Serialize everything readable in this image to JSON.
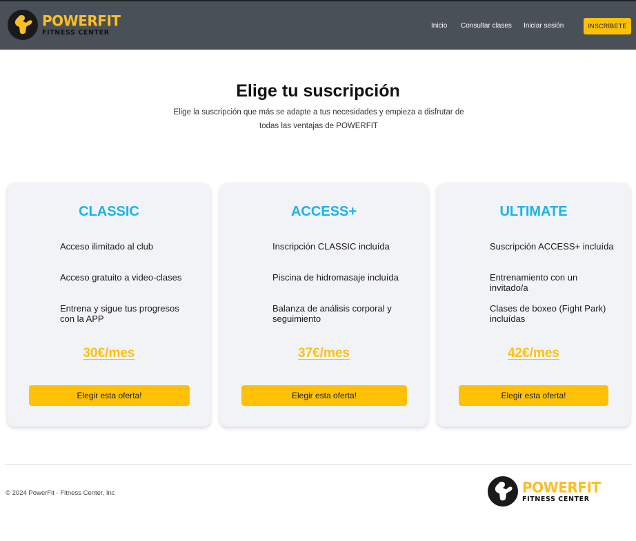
{
  "brand": {
    "name": "POWERFIT",
    "subtitle": "FITNESS CENTER",
    "color": "#fbbf24"
  },
  "nav": {
    "links": [
      "Inicio",
      "Consultar clases",
      "Iniciar sesión"
    ],
    "cta": "INSCRÍBETE"
  },
  "hero": {
    "title": "Elige tu suscripción",
    "subtitle": "Elige la suscripción que más se adapte a tus necesidades y empieza a disfrutar de todas las ventajas de POWERFIT"
  },
  "plans": [
    {
      "name": "CLASSIC",
      "features": [
        "Acceso ilimitado al club",
        "Acceso gratuito a video-clases",
        "Entrena y sigue tus progresos con la APP"
      ],
      "price": "30€/mes",
      "button": "Elegir esta oferta!"
    },
    {
      "name": "ACCESS+",
      "features": [
        "Inscripción CLASSIC incluída",
        "Piscina de hidromasaje incluída",
        "Balanza de análisis corporal y seguimiento"
      ],
      "price": "37€/mes",
      "button": "Elegir esta oferta!"
    },
    {
      "name": "ULTIMATE",
      "features": [
        "Suscripción ACCESS+ incluída",
        "Entrenamiento con un invitado/a",
        "Clases de boxeo (Fight Park) incluídas"
      ],
      "price": "42€/mes",
      "button": "Elegir esta oferta!"
    }
  ],
  "footer": {
    "copyright": "© 2024 PowerFit - Fitness Center, Inc"
  },
  "colors": {
    "accent": "#ffc107",
    "plan_title": "#1ab3e8",
    "navbar": "#495057"
  }
}
